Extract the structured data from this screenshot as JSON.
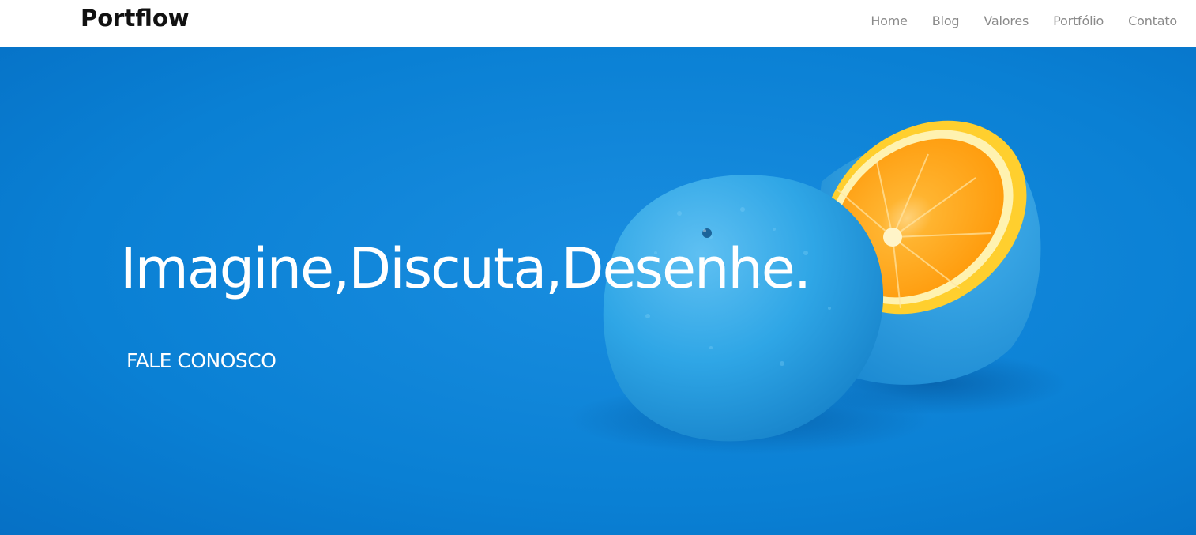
{
  "navbar": {
    "brand": "Portflow",
    "links": [
      {
        "label": "Home"
      },
      {
        "label": "Blog"
      },
      {
        "label": "Valores"
      },
      {
        "label": "Portfólio"
      },
      {
        "label": "Contato"
      }
    ]
  },
  "hero": {
    "title": "Imagine,Discuta,Desenhe.",
    "cta_label": "FALE CONOSCO",
    "background_color": "#0980d3",
    "image_subject": "blue-painted-orange-halves"
  }
}
